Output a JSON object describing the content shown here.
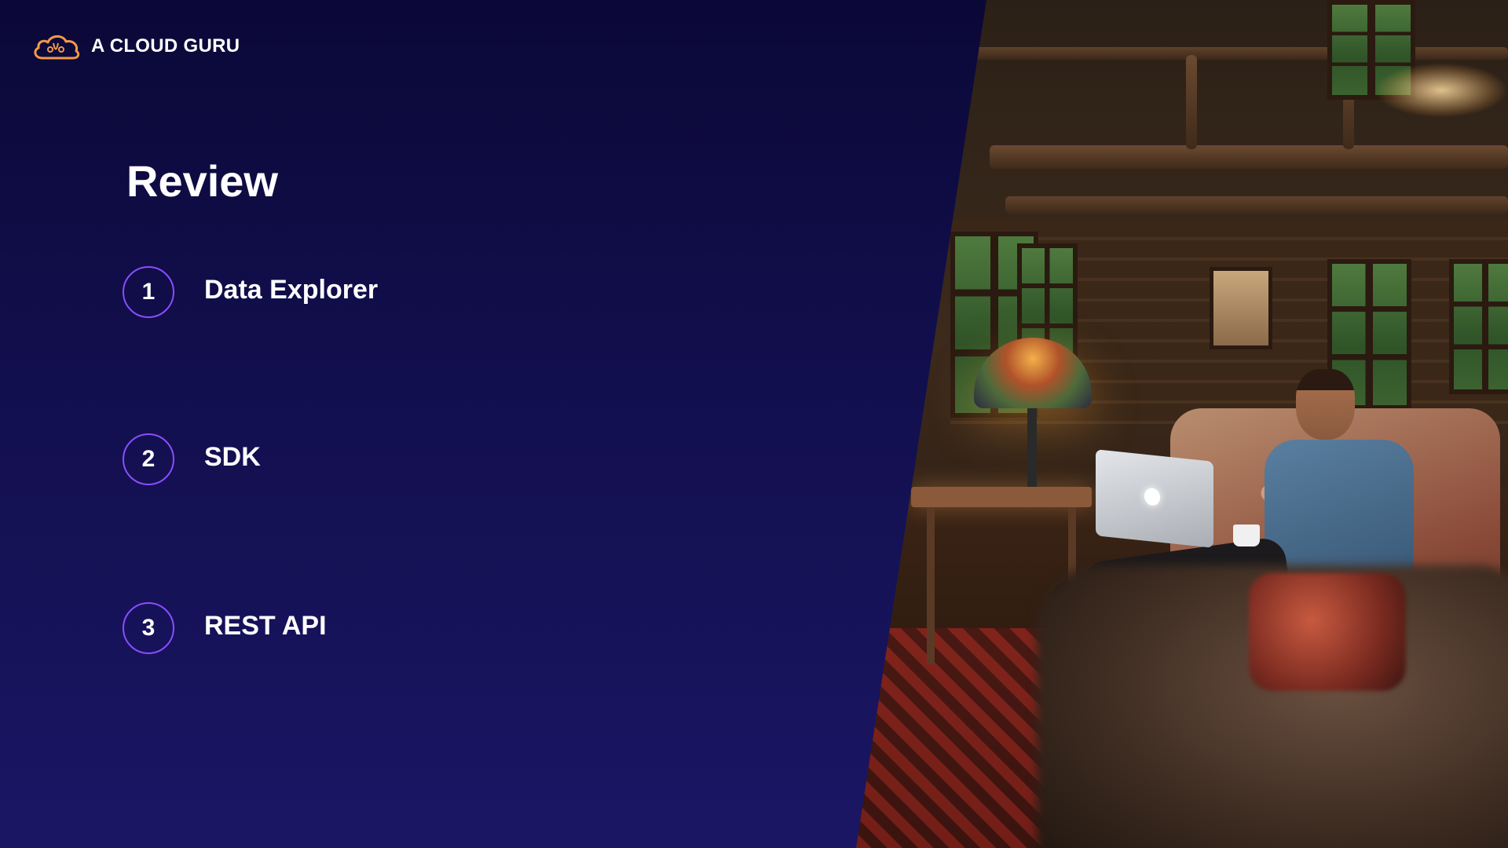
{
  "brand": {
    "name": "A CLOUD GURU",
    "logo_icon": "cloud-logo-icon",
    "logo_color": "#f2994a"
  },
  "slide": {
    "title": "Review",
    "items": [
      {
        "number": "1",
        "label": "Data Explorer"
      },
      {
        "number": "2",
        "label": "SDK"
      },
      {
        "number": "3",
        "label": "REST API"
      }
    ]
  },
  "colors": {
    "background_top": "#0b0838",
    "background_bottom": "#1a1664",
    "accent_circle": "#8a4dff",
    "text": "#ffffff"
  },
  "photo": {
    "subject": "man-with-laptop-in-log-cabin-photo"
  }
}
